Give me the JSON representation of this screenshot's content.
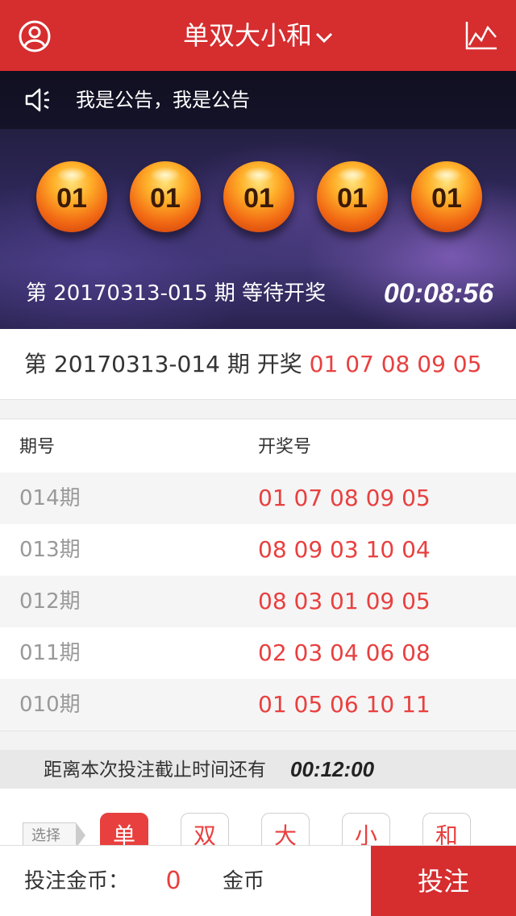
{
  "header": {
    "title": "单双大小和",
    "user_icon": "user-icon",
    "chart_icon": "trend-chart-icon",
    "chevron_icon": "chevron-down-icon"
  },
  "notice": {
    "icon": "speaker-icon",
    "text": "我是公告，我是公告"
  },
  "current_draw": {
    "balls": [
      "01",
      "01",
      "01",
      "01",
      "01"
    ],
    "issue_text": "第 20170313-015 期 等待开奖",
    "countdown": "00:08:56"
  },
  "last_draw": {
    "prefix": "第 20170313-014 期 开奖",
    "numbers": "01 07 08 09 05"
  },
  "history": {
    "col_period": "期号",
    "col_result": "开奖号",
    "rows": [
      {
        "period": "014期",
        "result": "01 07 08 09 05"
      },
      {
        "period": "013期",
        "result": "08 09 03 10 04"
      },
      {
        "period": "012期",
        "result": "08 03 01 09 05"
      },
      {
        "period": "011期",
        "result": "02 03 04 06 08"
      },
      {
        "period": "010期",
        "result": "01 05 06 10 11"
      }
    ]
  },
  "deadline": {
    "label": "距离本次投注截止时间还有",
    "time": "00:12:00"
  },
  "options": {
    "select_label": "选择",
    "items": [
      {
        "label": "单",
        "selected": true
      },
      {
        "label": "双",
        "selected": false
      },
      {
        "label": "大",
        "selected": false
      },
      {
        "label": "小",
        "selected": false
      },
      {
        "label": "和",
        "selected": false
      }
    ]
  },
  "footer": {
    "amount_label": "投注金币：",
    "amount": "0",
    "unit": "金币",
    "bet_button": "投注"
  },
  "colors": {
    "primary_red": "#d62d2f",
    "number_red": "#e8403f"
  }
}
